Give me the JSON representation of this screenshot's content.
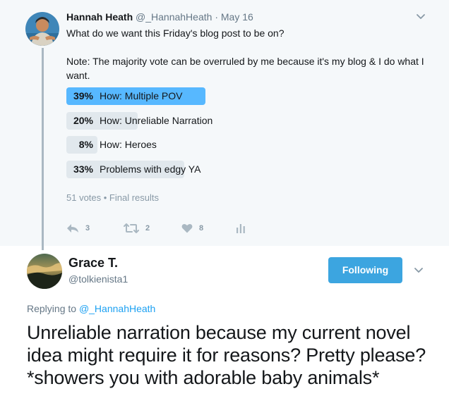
{
  "parent_tweet": {
    "name": "Hannah Heath",
    "handle": "@_HannahHeath",
    "separator": "·",
    "date": "May 16",
    "question": "What do we want this Friday's blog post to be on?",
    "note": "Note: The majority vote can be overruled by me because it's my blog & I do what I want.",
    "poll": {
      "options": [
        {
          "percent": "39%",
          "label": "How: Multiple POV",
          "share": 0.39,
          "winner": true
        },
        {
          "percent": "20%",
          "label": "How: Unreliable Narration",
          "share": 0.2,
          "winner": false
        },
        {
          "percent": "8%",
          "label": "How: Heroes",
          "share": 0.08,
          "winner": false
        },
        {
          "percent": "33%",
          "label": "Problems with edgy YA",
          "share": 0.33,
          "winner": false
        }
      ],
      "summary": "51 votes • Final results",
      "winner_color": "#57b8ff",
      "bar_color": "#e1e8ed"
    },
    "actions": {
      "replies": "3",
      "retweets": "2",
      "likes": "8"
    }
  },
  "reply_tweet": {
    "name": "Grace T.",
    "handle": "@tolkienista1",
    "follow_label": "Following",
    "replying_prefix": "Replying to",
    "replying_handle": "@_HannahHeath",
    "text": "Unreliable narration because my current novel idea might require it for reasons? Pretty please? *showers you with adorable baby animals*"
  },
  "icons": [
    "chevron-down-icon",
    "reply-icon",
    "retweet-icon",
    "heart-icon",
    "analytics-icon"
  ]
}
